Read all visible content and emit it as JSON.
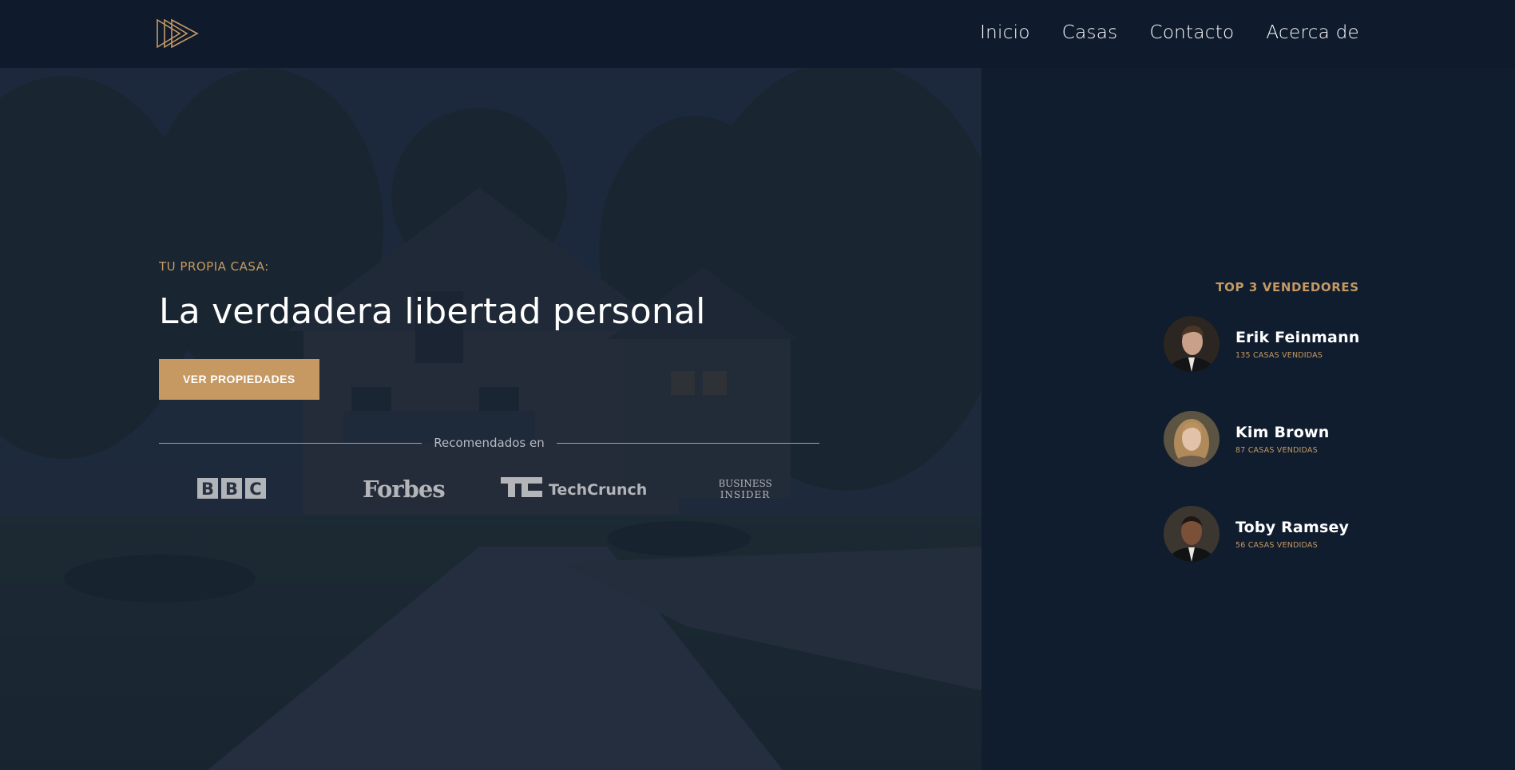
{
  "nav": {
    "items": [
      {
        "label": "Inicio"
      },
      {
        "label": "Casas"
      },
      {
        "label": "Contacto"
      },
      {
        "label": "Acerca de"
      }
    ]
  },
  "hero": {
    "eyebrow": "TU PROPIA CASA:",
    "headline": "La verdadera libertad personal",
    "cta_label": "VER PROPIEDADES",
    "recommended_label": "Recomendados en",
    "press": [
      {
        "name": "BBC",
        "icon": "bbc-logo"
      },
      {
        "name": "Forbes",
        "icon": "forbes-logo"
      },
      {
        "name": "TechCrunch",
        "icon": "techcrunch-logo"
      },
      {
        "name": "Business Insider",
        "icon": "business-insider-logo"
      }
    ]
  },
  "sidebar": {
    "title": "TOP 3 VENDEDORES",
    "sellers": [
      {
        "name": "Erik Feinmann",
        "sales": "135 CASAS VENDIDAS"
      },
      {
        "name": "Kim Brown",
        "sales": "87 CASAS VENDIDAS"
      },
      {
        "name": "Toby Ramsey",
        "sales": "56 CASAS VENDIDAS"
      }
    ]
  },
  "colors": {
    "accent": "#c69963",
    "background": "#101d2e",
    "topbar": "#0f1b2c",
    "text": "#ffffff"
  }
}
